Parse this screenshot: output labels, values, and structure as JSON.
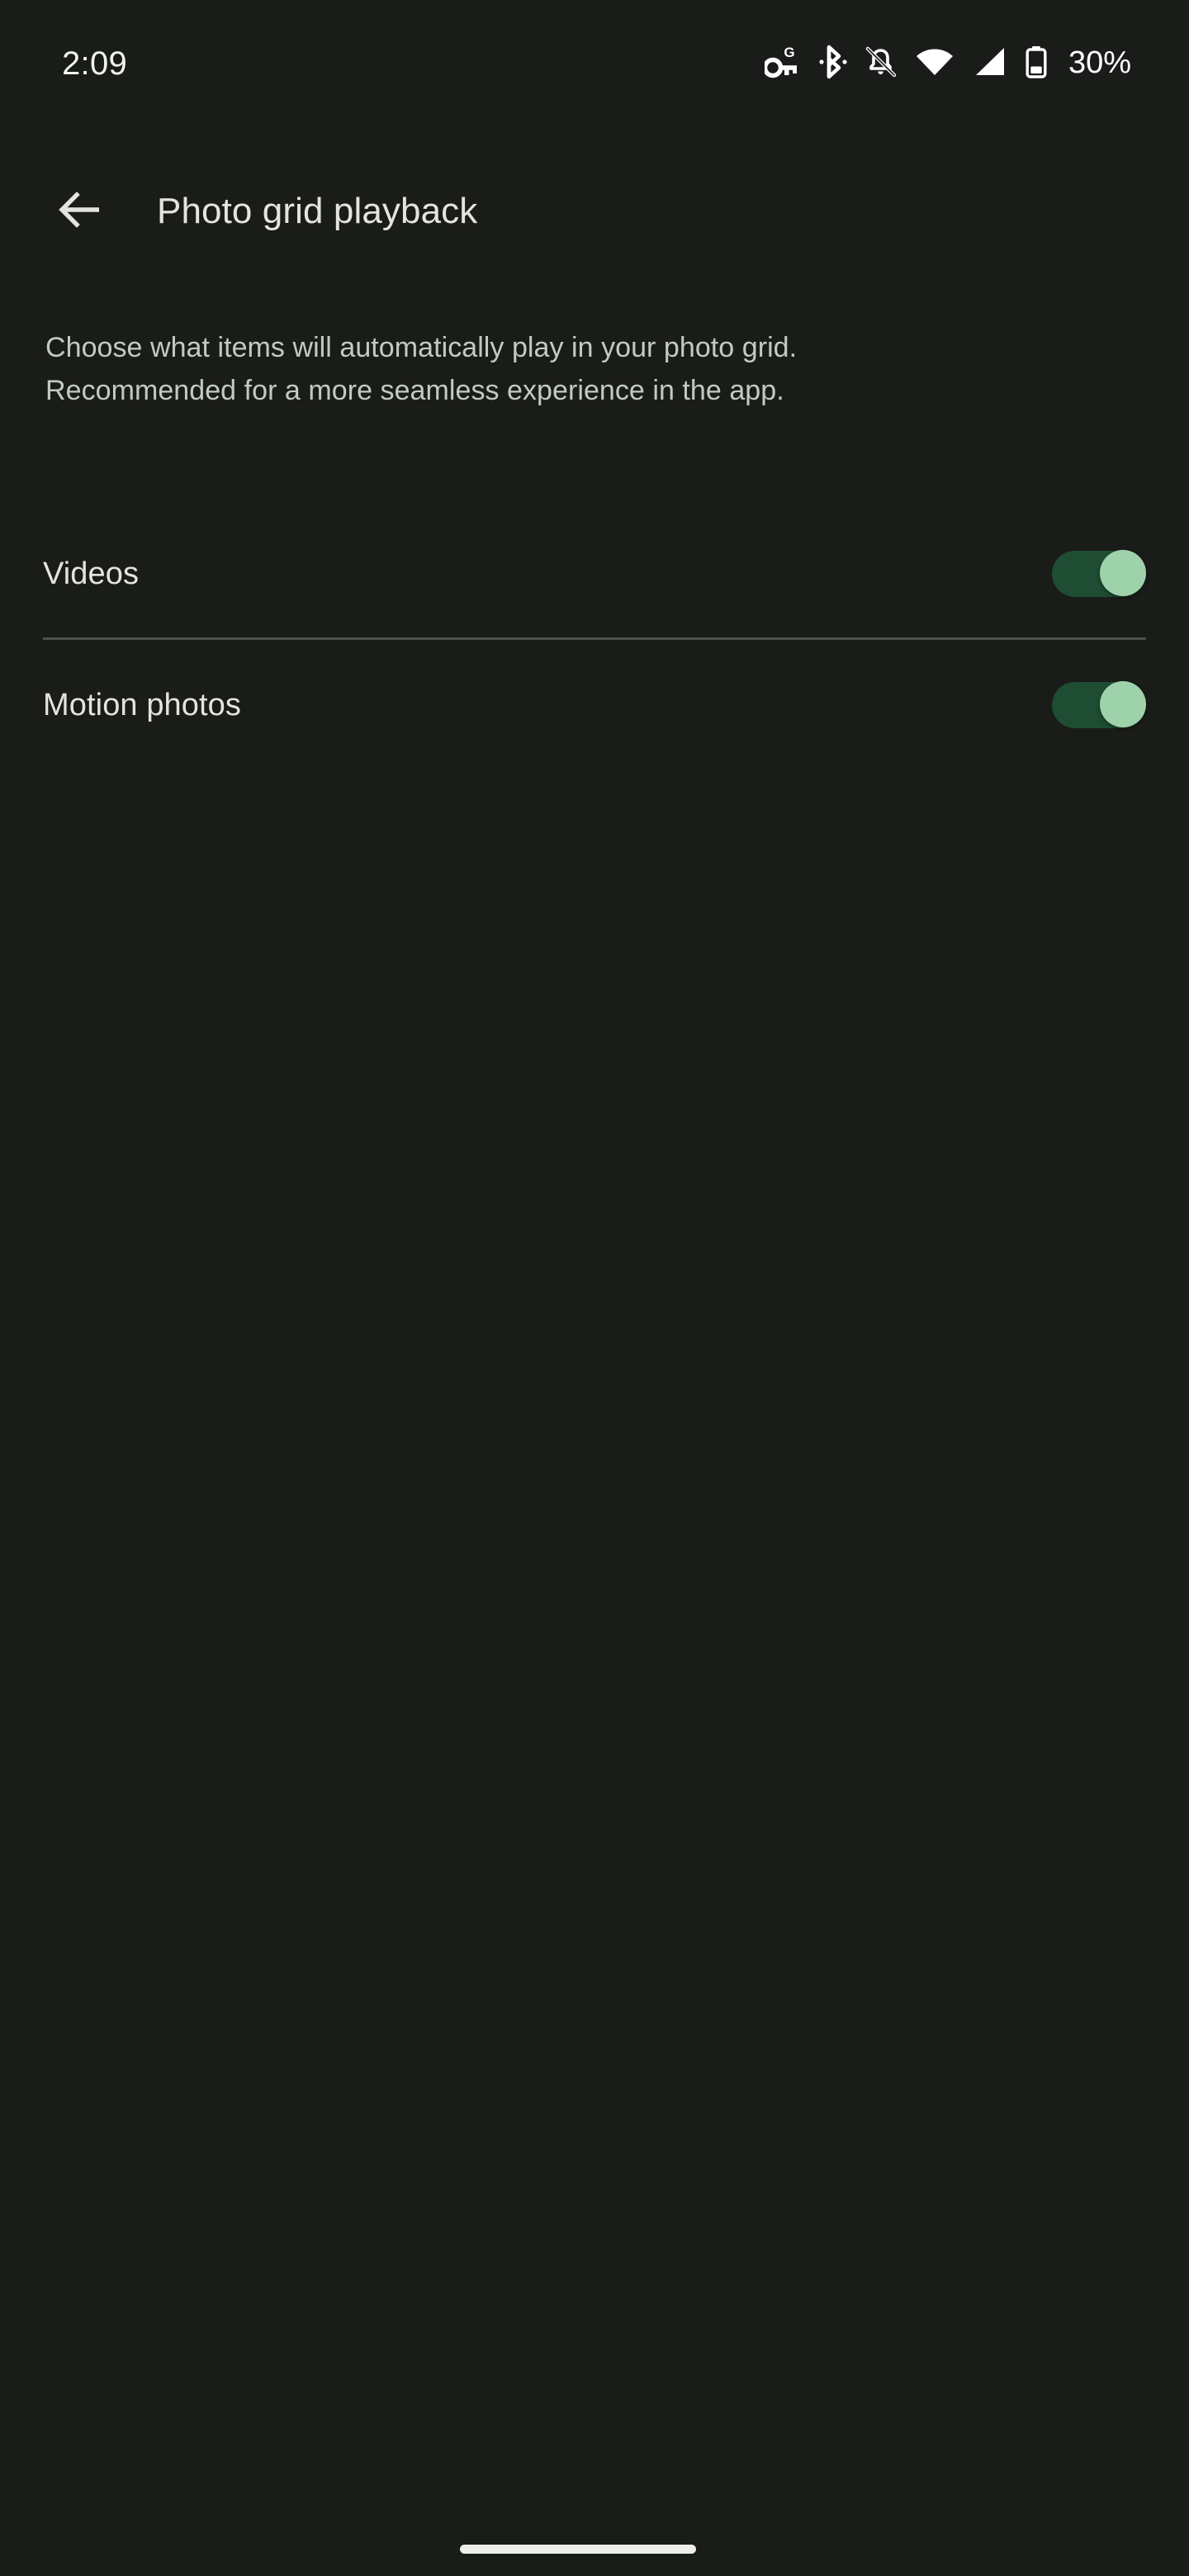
{
  "status_bar": {
    "time": "2:09",
    "battery_percent": "30%",
    "icons": [
      {
        "name": "vpn-key-google-icon",
        "label": "VPN key (Google)"
      },
      {
        "name": "bluetooth-icon",
        "label": "Bluetooth"
      },
      {
        "name": "notifications-off-icon",
        "label": "Notifications silenced"
      },
      {
        "name": "wifi-icon",
        "label": "Wi-Fi full signal"
      },
      {
        "name": "cellular-signal-icon",
        "label": "Mobile signal full"
      },
      {
        "name": "battery-icon",
        "label": "Battery"
      }
    ]
  },
  "app_bar": {
    "back_icon": "arrow-back-icon",
    "title": "Photo grid playback"
  },
  "description": {
    "line1": "Choose what items will automatically play in your photo grid.",
    "line2": "Recommended for a more seamless experience in the app."
  },
  "settings": {
    "rows": [
      {
        "label": "Videos",
        "enabled": true,
        "state": "on"
      },
      {
        "label": "Motion photos",
        "enabled": true,
        "state": "on"
      }
    ]
  },
  "colors": {
    "background": "#1a1c19",
    "title_text": "#e3e4de",
    "body_text": "#c5cabf",
    "divider": "#4b514a",
    "switch_track_on": "#1e4d33",
    "switch_thumb_on": "#9ed2ab",
    "status_icon": "#ffffff",
    "home_indicator": "#eceee8"
  },
  "navigation": {
    "home_indicator": "home-indicator"
  }
}
